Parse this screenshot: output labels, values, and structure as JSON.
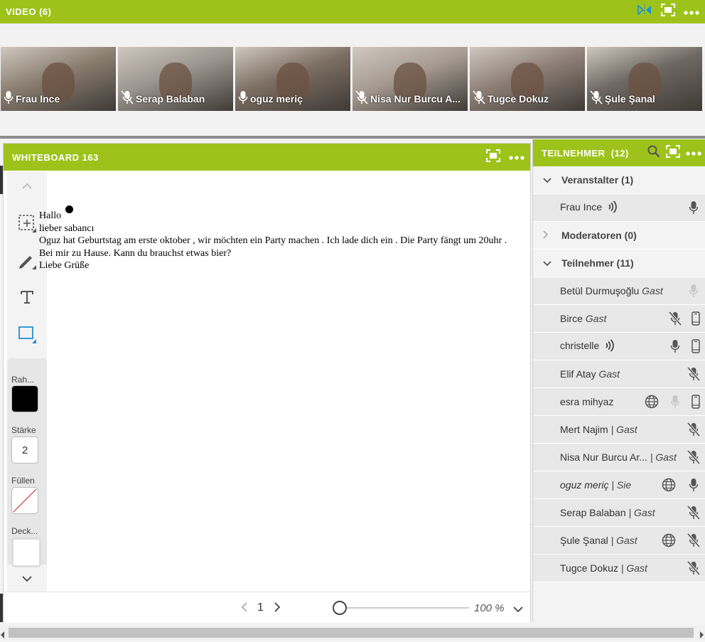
{
  "video": {
    "title": "VIDEO (6)",
    "tiles": [
      {
        "name": "Frau Ince",
        "mic": "mic-on",
        "active": true,
        "color": "#8a7d70"
      },
      {
        "name": "Serap Balaban",
        "mic": "mic-off",
        "active": false,
        "color": "#9a958e"
      },
      {
        "name": "oguz meriç",
        "mic": "mic-on",
        "active": false,
        "color": "#7c6e62"
      },
      {
        "name": "Nisa Nur Burcu A...",
        "mic": "mic-off",
        "active": false,
        "color": "#a69b91"
      },
      {
        "name": "Tugce Dokuz",
        "mic": "mic-off",
        "active": false,
        "color": "#8e7f76"
      },
      {
        "name": "Şule Şanal",
        "mic": "mic-off",
        "active": false,
        "color": "#6e6862"
      }
    ]
  },
  "whiteboard": {
    "title": "WHITEBOARD 163",
    "text_lines": [
      "Hallo",
      "lieber sabancı",
      "Oguz hat Geburtstag am erste oktober , wir möchten ein Party machen . Ich lade dich ein . Die Party fängt um 20uhr .",
      "Bei mir zu Hause. Kann du brauchst etwas bier?",
      "Liebe Grüße"
    ],
    "props": {
      "stroke_label": "Rah...",
      "stroke_color": "#000000",
      "width_label": "Stärke",
      "width_value": "2",
      "fill_label": "Füllen",
      "opacity_label": "Deck..."
    },
    "page": "1",
    "zoom": "100 %"
  },
  "participants": {
    "title": "TEILNEHMER",
    "count": "(12)",
    "groups": [
      {
        "label": "Veranstalter (1)",
        "expanded": true,
        "members": [
          {
            "name": "Frau Ince",
            "role": "",
            "speaking": true,
            "globe": false,
            "mic": "mic-on",
            "phone": false
          }
        ]
      },
      {
        "label": "Moderatoren (0)",
        "expanded": false,
        "members": []
      },
      {
        "label": "Teilnehmer (11)",
        "expanded": true,
        "members": [
          {
            "name": "Betül Durmuşoğlu",
            "role": "Gast",
            "speaking": false,
            "globe": false,
            "mic": "mic-dim",
            "phone": false
          },
          {
            "name": "Birce",
            "role": "Gast",
            "speaking": false,
            "globe": false,
            "mic": "mic-off",
            "phone": true
          },
          {
            "name": "christelle",
            "role": "",
            "speaking": true,
            "globe": false,
            "mic": "mic-on",
            "phone": true
          },
          {
            "name": "Elif Atay",
            "role": "Gast",
            "speaking": false,
            "globe": false,
            "mic": "mic-off",
            "phone": false
          },
          {
            "name": "esra mihyaz",
            "role": "",
            "speaking": false,
            "globe": true,
            "mic": "mic-dim",
            "phone": true
          },
          {
            "name": "Mert Najim",
            "role": "| Gast",
            "speaking": false,
            "globe": false,
            "mic": "mic-off",
            "phone": false
          },
          {
            "name": "Nisa Nur Burcu Ar...",
            "role": "| Gast",
            "speaking": false,
            "globe": false,
            "mic": "mic-off",
            "phone": false
          },
          {
            "name": "oguz meriç",
            "role": "| Sie",
            "speaking": false,
            "globe": true,
            "mic": "mic-on",
            "phone": false,
            "italic": true
          },
          {
            "name": "Serap Balaban",
            "role": "| Gast",
            "speaking": false,
            "globe": false,
            "mic": "mic-off",
            "phone": false
          },
          {
            "name": "Şule Şanal",
            "role": "| Gast",
            "speaking": false,
            "globe": true,
            "mic": "mic-off",
            "phone": false
          },
          {
            "name": "Tugce Dokuz",
            "role": "| Gast",
            "speaking": false,
            "globe": false,
            "mic": "mic-off",
            "phone": false
          }
        ]
      }
    ]
  },
  "colors": {
    "accent": "#9dc31b",
    "active_video_border": "#4dbf4a"
  }
}
